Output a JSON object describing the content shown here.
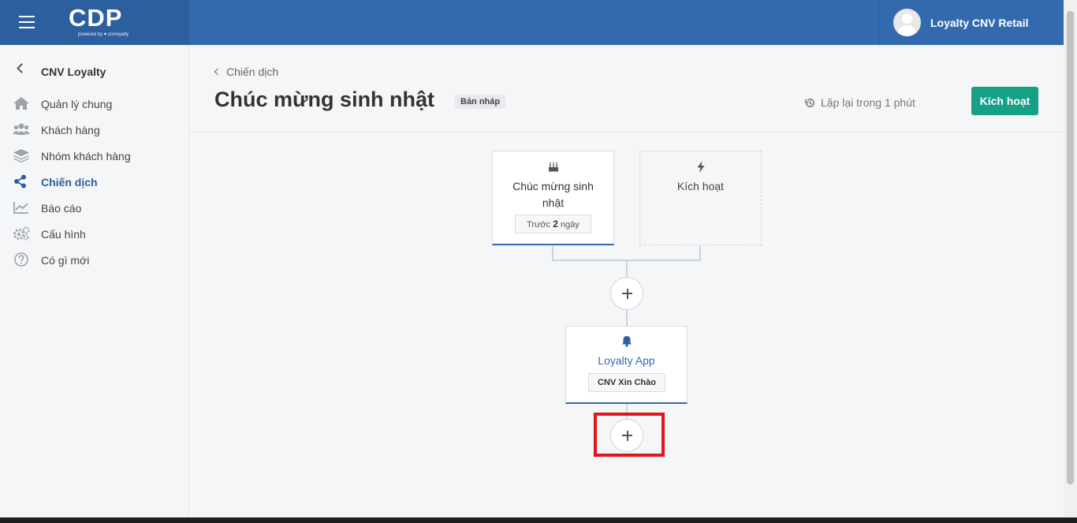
{
  "header": {
    "logo_text": "CDP",
    "logo_sub": "powered by ♥ cnvloyalty",
    "user_name": "Loyalty CNV Retail"
  },
  "sidebar": {
    "back_label": "CNV Loyalty",
    "items": [
      {
        "label": "Quản lý chung",
        "icon": "home-icon"
      },
      {
        "label": "Khách hàng",
        "icon": "users-icon"
      },
      {
        "label": "Nhóm khách hàng",
        "icon": "layers-icon"
      },
      {
        "label": "Chiến dịch",
        "icon": "share-icon",
        "active": true
      },
      {
        "label": "Báo cáo",
        "icon": "line-chart-icon"
      },
      {
        "label": "Cấu hình",
        "icon": "gears-icon"
      },
      {
        "label": "Có gì mới",
        "icon": "help-circle-icon"
      }
    ]
  },
  "page": {
    "breadcrumb": "Chiến dịch",
    "title": "Chúc mừng sinh nhật",
    "status_badge": "Bản nháp",
    "repeat_text": "Lặp lại trong 1 phút",
    "activate_button": "Kích hoạt"
  },
  "flow": {
    "trigger_node": {
      "title_line1": "Chúc mừng sinh",
      "title_line2": "nhật",
      "chip_prefix": "Trước",
      "chip_value": "2",
      "chip_suffix": "ngày",
      "icon": "birthday-cake-icon"
    },
    "placeholder_node": {
      "title": "Kích hoạt",
      "icon": "lightning-bolt-icon"
    },
    "action_node": {
      "title": "Loyalty App",
      "chip": "CNV Xin Chào",
      "icon": "bell-icon"
    }
  },
  "colors": {
    "header_bg": "#336aae",
    "activate_green": "#16a085",
    "highlight_red": "#e3141c"
  }
}
